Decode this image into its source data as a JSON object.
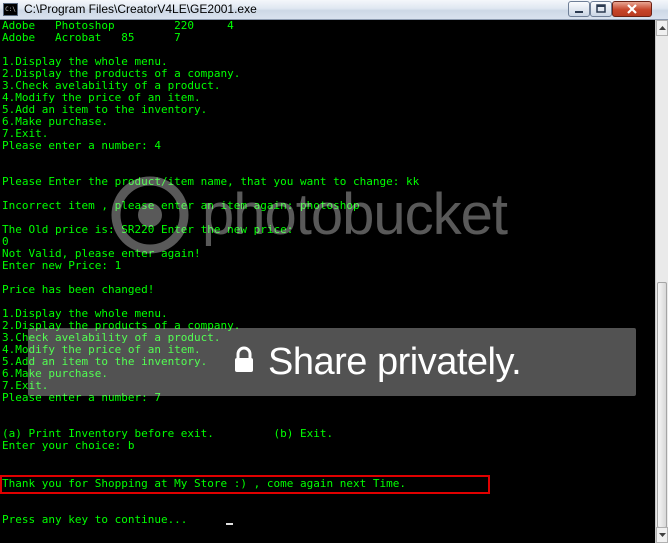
{
  "window": {
    "title": "C:\\Program Files\\CreatorV4LE\\GE2001.exe",
    "icon_label": "C:\\"
  },
  "console": {
    "lines": [
      "Adobe   Photoshop         220     4",
      "Adobe   Acrobat   85      7",
      "",
      "1.Display the whole menu.",
      "2.Display the products of a company.",
      "3.Check avelability of a product.",
      "4.Modify the price of an item.",
      "5.Add an item to the inventory.",
      "6.Make purchase.",
      "7.Exit.",
      "Please enter a number: 4",
      "",
      "",
      "Please Enter the product/item name, that you want to change: kk",
      "",
      "Incorrect item , please enter an item again: photoshop",
      "",
      "The Old price is: SR220 Enter the new price:",
      "0",
      "Not Valid, please enter again!",
      "Enter new Price: 1",
      "",
      "Price has been changed!",
      "",
      "1.Display the whole menu.",
      "2.Display the products of a company.",
      "3.Check avelability of a product.",
      "4.Modify the price of an item.",
      "5.Add an item to the inventory.",
      "6.Make purchase.",
      "7.Exit.",
      "Please enter a number: 7",
      "",
      "",
      "(a) Print Inventory before exit.         (b) Exit.",
      "Enter your choice: b",
      "",
      "",
      "Thank you for Shopping at My Store :) , come again next Time.",
      "",
      "",
      "Press any key to continue..."
    ]
  },
  "watermark": {
    "brand": "photobucket",
    "share_text": "Share privately."
  },
  "colors": {
    "console_text": "#00ff00",
    "console_background": "#000000",
    "highlight_border": "#e00000"
  }
}
